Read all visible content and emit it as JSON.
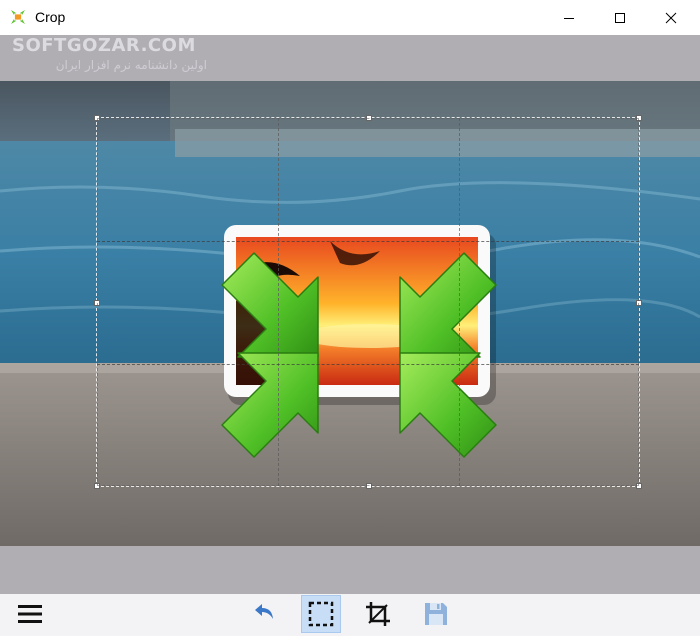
{
  "window": {
    "title": "Crop",
    "controls": [
      "minimize",
      "maximize",
      "close"
    ]
  },
  "watermark": {
    "main": "SOFTGOZAR.COM",
    "sub": "اولین دانشنامه نرم افزار ایران"
  },
  "toolbar": {
    "buttons": [
      {
        "name": "menu",
        "icon": "hamburger-icon",
        "state": "normal"
      },
      {
        "name": "undo",
        "icon": "undo-icon",
        "state": "normal"
      },
      {
        "name": "select",
        "icon": "selection-icon",
        "state": "active"
      },
      {
        "name": "crop",
        "icon": "crop-icon",
        "state": "normal"
      },
      {
        "name": "save",
        "icon": "save-icon",
        "state": "disabled"
      }
    ]
  },
  "colors": {
    "canvas_bg": "#b0aeb3",
    "toolbar_bg": "#f3f3f5",
    "active_button": "#c8def7",
    "accent_blue": "#3b78c8",
    "arrow_green": "#5cc22c"
  }
}
